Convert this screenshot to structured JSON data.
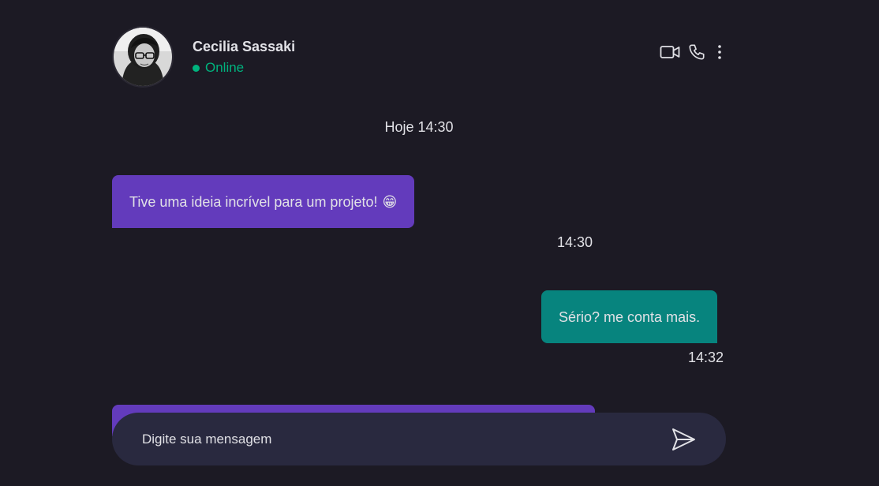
{
  "contact": {
    "name": "Cecilia Sassaki",
    "status": "Online",
    "avatar_icon": "user-avatar"
  },
  "header_actions": [
    {
      "name": "video-call-icon"
    },
    {
      "name": "phone-call-icon"
    },
    {
      "name": "more-options-icon"
    }
  ],
  "date_separator": "Hoje 14:30",
  "messages": [
    {
      "direction": "incoming",
      "text": "Tive uma ideia incrível para um projeto!",
      "emoji": "😁",
      "time": "14:30"
    },
    {
      "direction": "outgoing",
      "text": "Sério? me conta mais.",
      "time": "14:32"
    }
  ],
  "composer": {
    "placeholder": "Digite sua mensagem",
    "send_icon": "send-icon"
  },
  "colors": {
    "background": "#1c1a24",
    "incoming_bubble": "#633bbc",
    "outgoing_bubble": "#07847e",
    "online": "#00b37e",
    "composer": "#29293f"
  }
}
